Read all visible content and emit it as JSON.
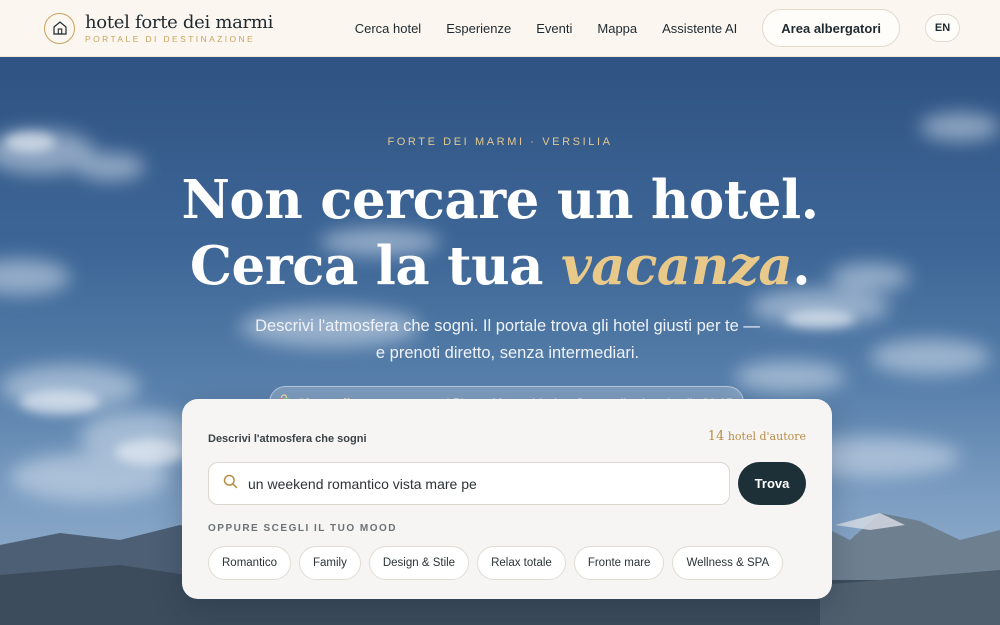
{
  "header": {
    "logo_title": "hotel forte dei marmi",
    "logo_subtitle": "PORTALE DI DESTINAZIONE",
    "nav": [
      "Cerca hotel",
      "Esperienze",
      "Eventi",
      "Mappa",
      "Assistente AI"
    ],
    "area_button": "Area albergatori",
    "lang_button": "EN"
  },
  "hero": {
    "kicker": "FORTE DEI MARMI · VERSILIA",
    "headline_line1": "Non cercare un hotel.",
    "headline_line2_start": "Cerca la tua ",
    "headline_line2_accent": "vacanza",
    "headline_line2_end": ".",
    "subtitle": "Descrivi l'atmosfera che sogni. Il portale trova gli hotel giusti per te — e prenoti diretto, senza intermediari.",
    "notice_icon": "shopping-bag-icon",
    "notice_label": "Giorno di mercato:",
    "notice_text": "stamani Piazza Marconi è viva. Stasera il sole cala alle",
    "notice_time": "21:05",
    "notice_end": "."
  },
  "search": {
    "label": "Descrivi l'atmosfera che sogni",
    "count_number": "14",
    "count_text": "hotel d'autore",
    "input_value": "un weekend romantico vista mare pe",
    "button": "Trova",
    "mood_label": "OPPURE SCEGLI IL TUO MOOD",
    "moods": [
      "Romantico",
      "Family",
      "Design & Stile",
      "Relax totale",
      "Fronte mare",
      "Wellness & SPA"
    ]
  },
  "colors": {
    "accent_gold": "#c8a45e",
    "dark_button": "#1d3037",
    "header_bg": "#fbf6ef"
  }
}
